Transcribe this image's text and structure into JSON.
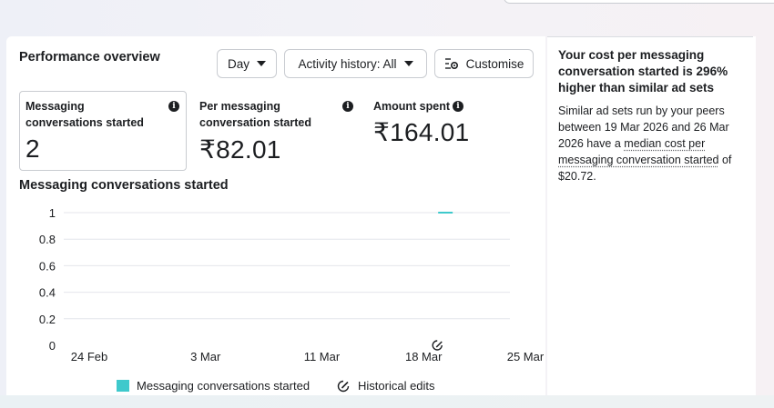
{
  "header": {
    "title": "Performance overview",
    "day_label": "Day",
    "activity_label": "Activity history: All",
    "customise_label": "Customise"
  },
  "metrics": [
    {
      "label": "Messaging conversations started",
      "value": "2"
    },
    {
      "label": "Per messaging conversation started",
      "value": "₹82.01"
    },
    {
      "label": "Amount spent",
      "value": "₹164.01"
    }
  ],
  "chart_data": {
    "type": "line",
    "title": "Messaging conversations started",
    "x_ticks": [
      "24 Feb",
      "3 Mar",
      "11 Mar",
      "18 Mar",
      "25 Mar"
    ],
    "y_ticks": [
      "0",
      "0.2",
      "0.4",
      "0.6",
      "0.8",
      "1"
    ],
    "ylim": [
      0,
      1
    ],
    "grid": true,
    "series": [
      {
        "name": "Messaging conversations started",
        "color": "#3ec9cc",
        "points": [
          {
            "x": "19 Mar",
            "y": 1
          },
          {
            "x": "20 Mar",
            "y": 1
          }
        ]
      }
    ],
    "edit_marker_x": "18 Mar",
    "legend": [
      {
        "label": "Messaging conversations started",
        "kind": "swatch",
        "color": "#3ec9cc"
      },
      {
        "label": "Historical edits",
        "kind": "edit-icon"
      }
    ]
  },
  "side": {
    "heading": "Your cost per messaging conversation started is 296% higher than similar ad sets",
    "body_pre": "Similar ad sets run by your peers between 19 Mar 2026 and 26 Mar 2026 have a ",
    "body_link": "median cost per messaging conversation started",
    "body_post": " of $20.72."
  }
}
